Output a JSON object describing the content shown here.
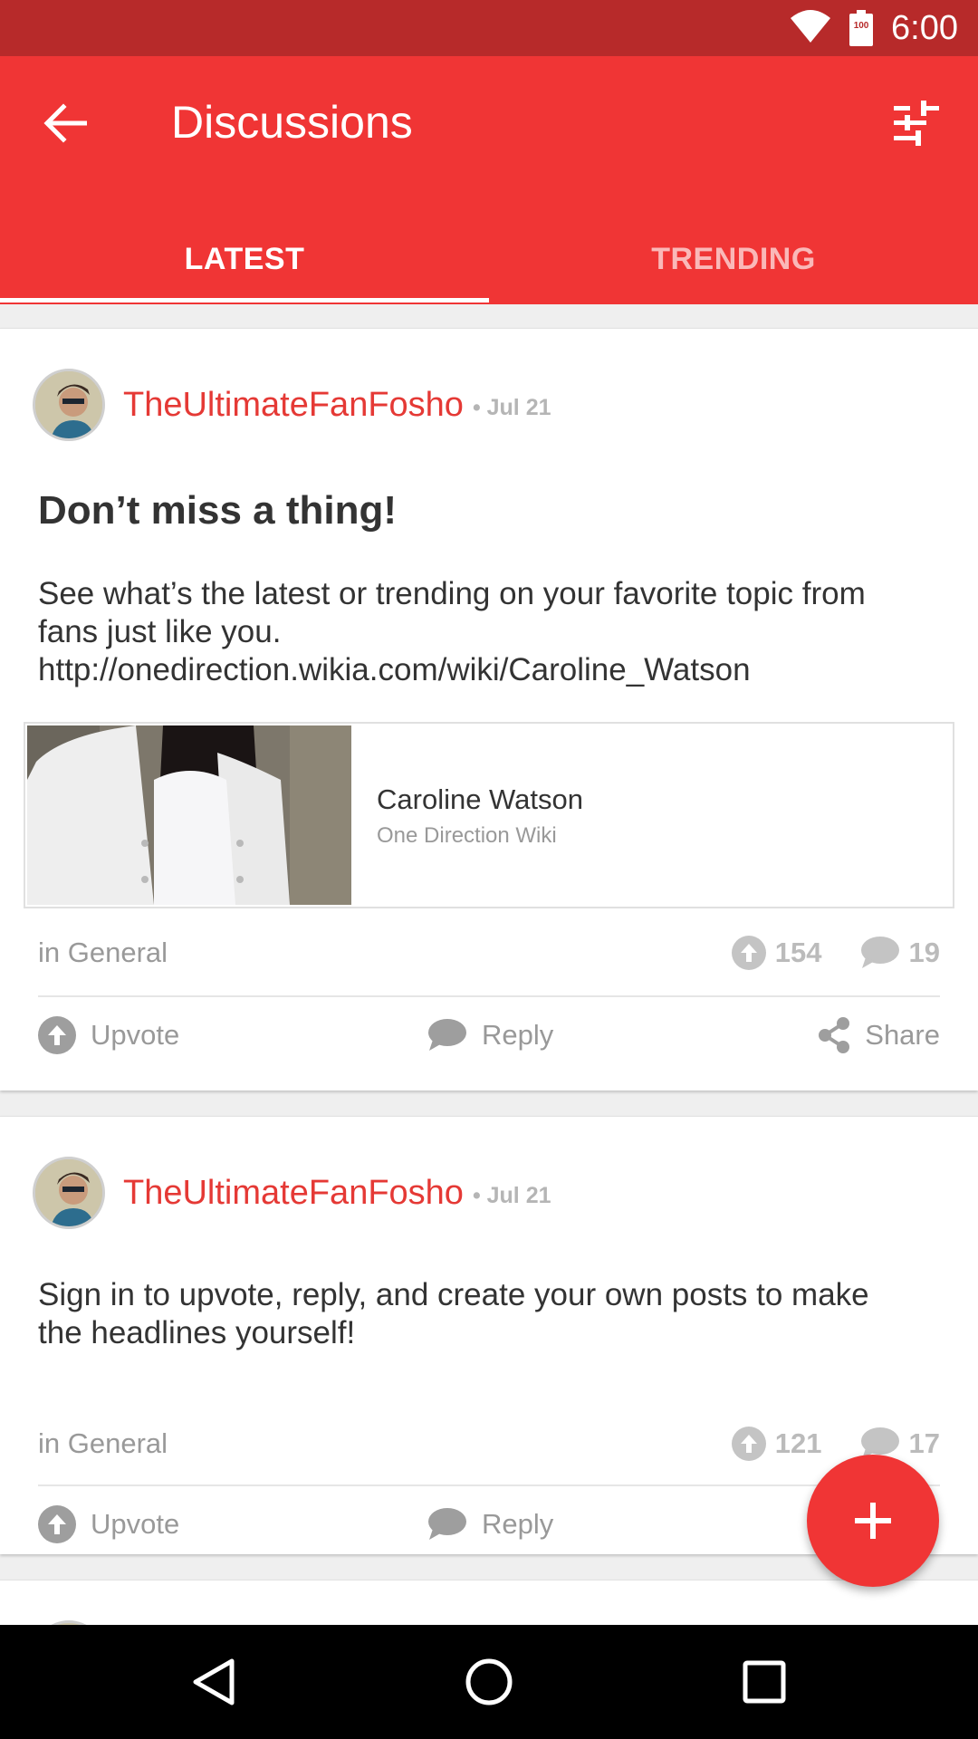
{
  "status_bar": {
    "time": "6:00",
    "battery_label": "100",
    "icons": [
      "wifi-icon",
      "battery-icon"
    ]
  },
  "app_bar": {
    "title": "Discussions",
    "back_icon": "arrow-back-icon",
    "filter_icon": "tune-sliders-icon"
  },
  "tabs": [
    {
      "label": "LATEST",
      "active": true
    },
    {
      "label": "TRENDING",
      "active": false
    }
  ],
  "posts": [
    {
      "author": "TheUltimateFanFosho",
      "date": "• Jul 21",
      "title": "Don’t miss a thing!",
      "body_lines": [
        "See what’s the latest or trending on your favorite topic from",
        "fans just like you.",
        "http://onedirection.wikia.com/wiki/Caroline_Watson"
      ],
      "link_preview": {
        "title": "Caroline Watson",
        "site": "One Direction Wiki"
      },
      "category": "in General",
      "upvotes": "154",
      "replies": "19",
      "actions": {
        "upvote": "Upvote",
        "reply": "Reply",
        "share": "Share"
      }
    },
    {
      "author": "TheUltimateFanFosho",
      "date": "• Jul 21",
      "body_lines": [
        "Sign in to upvote, reply, and create your own posts to make",
        "the headlines yourself!"
      ],
      "category": "in General",
      "upvotes": "121",
      "replies": "17",
      "actions": {
        "upvote": "Upvote",
        "reply": "Reply"
      }
    }
  ],
  "fab": {
    "icon": "plus-icon"
  },
  "nav_bar": {
    "icons": [
      "back-triangle-icon",
      "home-circle-icon",
      "recents-square-icon"
    ]
  },
  "colors": {
    "status_bar": "#b72a2a",
    "primary": "#f03535",
    "author": "#e53935"
  }
}
